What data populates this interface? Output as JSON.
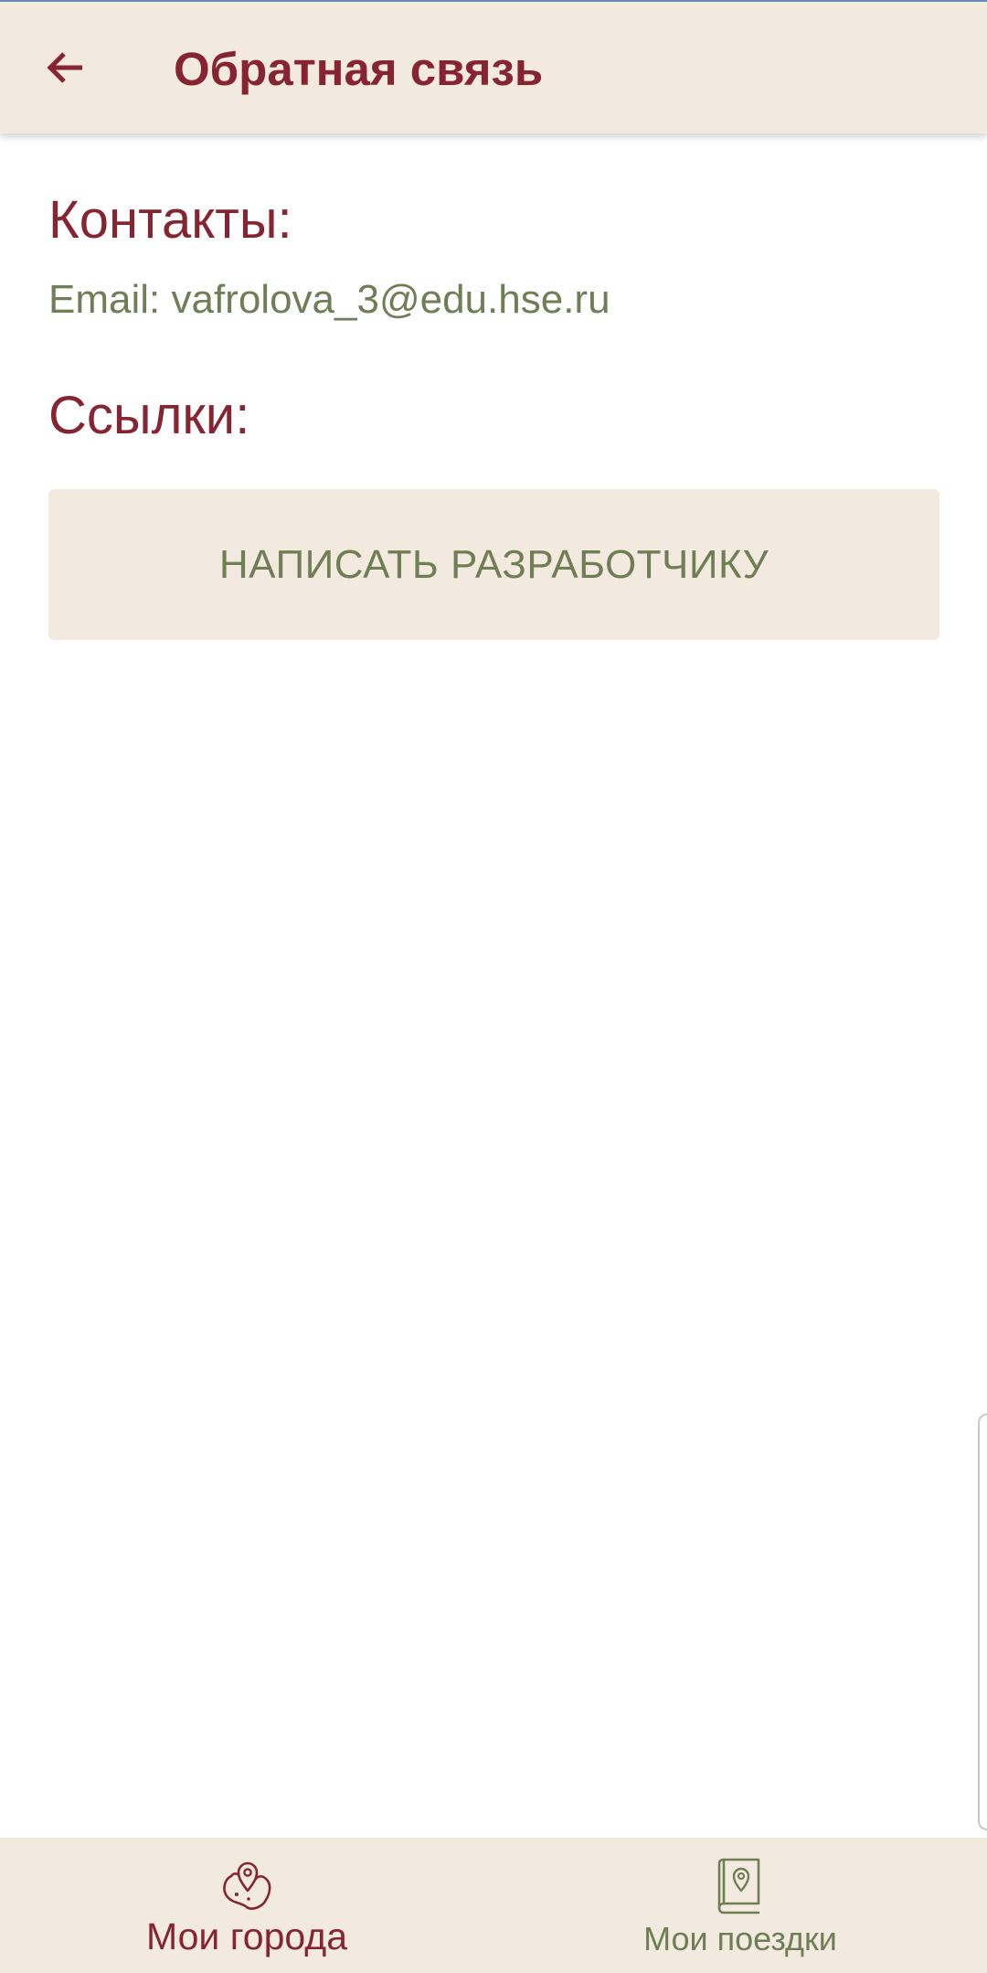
{
  "header": {
    "title": "Обратная связь",
    "back_icon": "arrow-left-icon"
  },
  "contacts": {
    "heading": "Контакты:",
    "email_line": "Email: vafrolova_3@edu.hse.ru"
  },
  "links": {
    "heading": "Ссылки:",
    "write_button_label": "НАПИСАТЬ РАЗРАБОТЧИКУ"
  },
  "bottom_nav": {
    "items": [
      {
        "label": "Мои города",
        "icon": "city-map-pin-icon",
        "active": true
      },
      {
        "label": "Мои поездки",
        "icon": "trip-book-icon",
        "active": false
      }
    ]
  },
  "colors": {
    "primary": "#862531",
    "secondary": "#6f7e55",
    "surface": "#f2eade",
    "background": "#ffffff"
  }
}
